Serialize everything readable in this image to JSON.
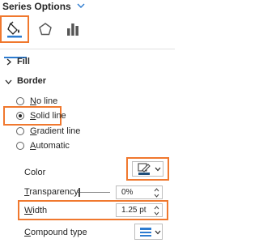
{
  "panel": {
    "title": "Series Options",
    "tabs": [
      {
        "name": "Fill & Line",
        "icon": "paint-bucket-icon"
      },
      {
        "name": "Effects",
        "icon": "pentagon-icon"
      },
      {
        "name": "Series Options",
        "icon": "bar-chart-icon"
      }
    ]
  },
  "sections": {
    "fill": {
      "label": "Fill"
    },
    "border": {
      "label": "Border"
    }
  },
  "border": {
    "options": [
      {
        "label": "No line",
        "checked": false
      },
      {
        "label": "Solid line",
        "checked": true
      },
      {
        "label": "Gradient line",
        "checked": false
      },
      {
        "label": "Automatic",
        "checked": false
      }
    ],
    "color": {
      "label": "Color",
      "icon": "pen-color-icon",
      "value": "#1f4e79"
    },
    "transparency": {
      "label": "Transparency",
      "value": "0%",
      "level": 0
    },
    "width": {
      "label": "Width",
      "value": "1.25 pt"
    },
    "compound_type": {
      "label": "Compound type",
      "icon": "compound-lines-icon"
    }
  },
  "colors": {
    "accent": "#f0782e",
    "blue": "#2c7bd0"
  }
}
